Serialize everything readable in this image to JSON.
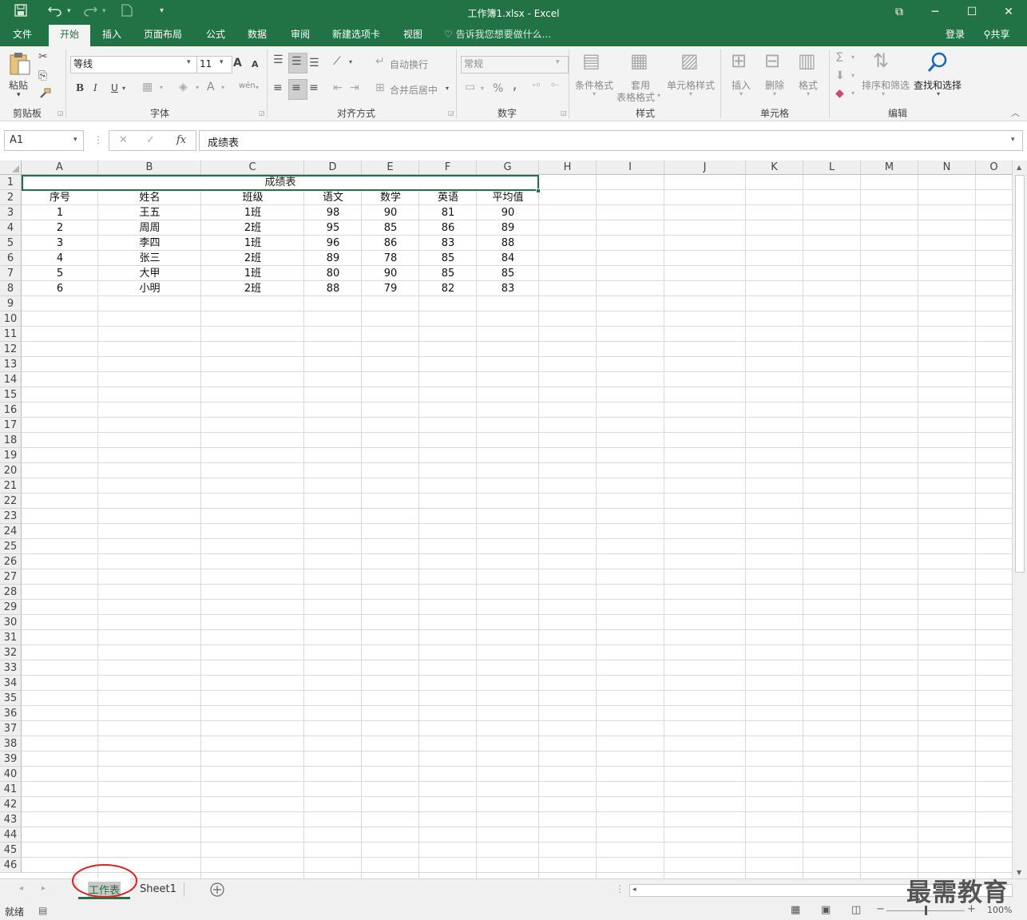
{
  "window": {
    "title": "工作簿1.xlsx - Excel",
    "controls": {
      "restore": "⧉",
      "minimize": "─",
      "maximize": "☐",
      "close": "✕"
    }
  },
  "quick_access": {
    "save_icon": "save-icon",
    "undo_icon": "undo-icon",
    "redo_icon": "redo-icon",
    "new_icon": "new-file-icon",
    "customize_icon": "customize-icon"
  },
  "ribbon_tabs": [
    "文件",
    "开始",
    "插入",
    "页面布局",
    "公式",
    "数据",
    "审阅",
    "新建选项卡",
    "视图"
  ],
  "active_tab": "开始",
  "tell_me": "告诉我您想要做什么...",
  "account": {
    "login": "登录",
    "share": "共享"
  },
  "ribbon": {
    "clipboard": {
      "paste": "粘贴",
      "label": "剪贴板"
    },
    "font": {
      "name": "等线",
      "size": "11",
      "bold": "B",
      "italic": "I",
      "underline": "U",
      "grow": "A",
      "shrink": "A",
      "font_color": "A",
      "phonetic": "wén",
      "label": "字体"
    },
    "alignment": {
      "wrap": "自动换行",
      "merge": "合并后居中",
      "label": "对齐方式"
    },
    "number": {
      "format": "常规",
      "percent": "%",
      "comma": ",",
      "label": "数字"
    },
    "styles": {
      "conditional": "条件格式",
      "table_line1": "套用",
      "table_line2": "表格格式",
      "cell_styles": "单元格样式",
      "label": "样式"
    },
    "cells": {
      "insert": "插入",
      "delete": "删除",
      "format": "格式",
      "label": "单元格"
    },
    "editing": {
      "sort": "排序和筛选",
      "find": "查找和选择",
      "label": "编辑"
    }
  },
  "formula_bar": {
    "name_box": "A1",
    "fx": "fx",
    "cancel": "✕",
    "enter": "✓",
    "content": "成绩表"
  },
  "columns": [
    "A",
    "B",
    "C",
    "D",
    "E",
    "F",
    "G",
    "H",
    "I",
    "J",
    "K",
    "L",
    "M",
    "N",
    "O"
  ],
  "visible_row_numbers": [
    1,
    2,
    3,
    4,
    5,
    6,
    7,
    8,
    9,
    10,
    11,
    12,
    13,
    14,
    15,
    16,
    17,
    18,
    19,
    20,
    21,
    22,
    23,
    24,
    25,
    26,
    27,
    28,
    29,
    30,
    31,
    32,
    33,
    34,
    35,
    36,
    37,
    38,
    39,
    40,
    41,
    42,
    43,
    44,
    45,
    46
  ],
  "sheet": {
    "title_cell": "成绩表",
    "headers": [
      "序号",
      "姓名",
      "班级",
      "语文",
      "数学",
      "英语",
      "平均值"
    ],
    "rows": [
      [
        "1",
        "王五",
        "1班",
        "98",
        "90",
        "81",
        "90"
      ],
      [
        "2",
        "周周",
        "2班",
        "95",
        "85",
        "86",
        "89"
      ],
      [
        "3",
        "李四",
        "1班",
        "96",
        "86",
        "83",
        "88"
      ],
      [
        "4",
        "张三",
        "2班",
        "89",
        "78",
        "85",
        "84"
      ],
      [
        "5",
        "大甲",
        "1班",
        "80",
        "90",
        "85",
        "85"
      ],
      [
        "6",
        "小明",
        "2班",
        "88",
        "79",
        "82",
        "83"
      ]
    ]
  },
  "sheet_tabs": [
    "工作表",
    "Sheet1"
  ],
  "active_sheet": "工作表",
  "status": {
    "ready": "就绪",
    "zoom": "100%"
  },
  "watermark": "最需教育",
  "colors": {
    "accent": "#217346",
    "selection": "#217346",
    "annotation": "#e02020"
  }
}
